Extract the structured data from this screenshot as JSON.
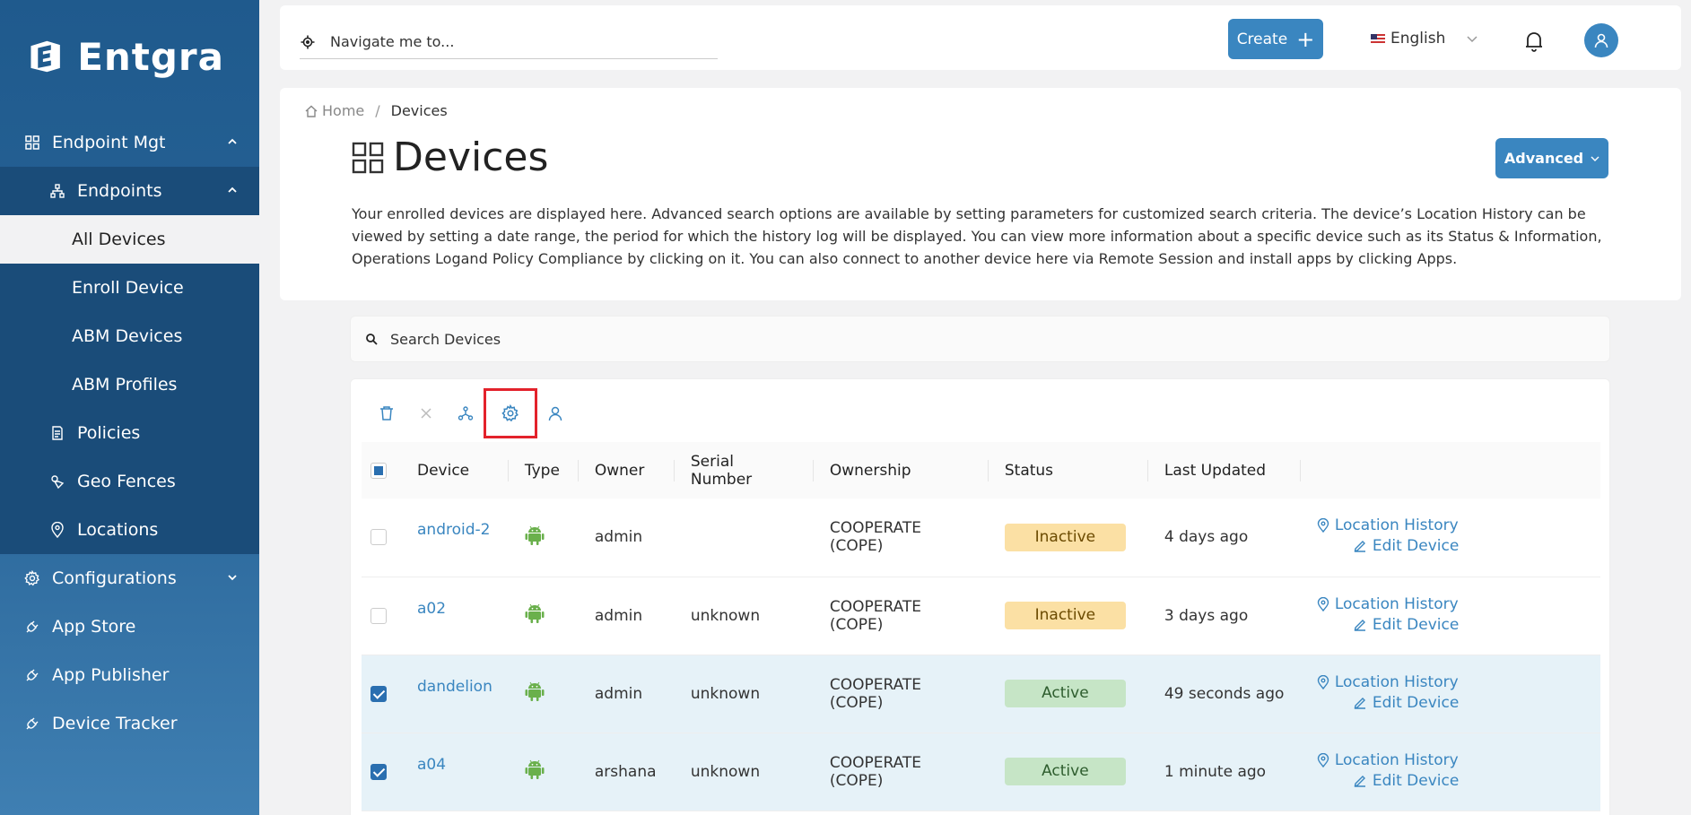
{
  "brand": {
    "name": "Entgra"
  },
  "sidebar": {
    "items": [
      {
        "label": "Endpoint Mgt"
      },
      {
        "label": "Endpoints"
      },
      {
        "label": "All Devices"
      },
      {
        "label": "Enroll Device"
      },
      {
        "label": "ABM Devices"
      },
      {
        "label": "ABM Profiles"
      },
      {
        "label": "Policies"
      },
      {
        "label": "Geo Fences"
      },
      {
        "label": "Locations"
      },
      {
        "label": "Configurations"
      },
      {
        "label": "App Store"
      },
      {
        "label": "App Publisher"
      },
      {
        "label": "Device Tracker"
      }
    ]
  },
  "header": {
    "search_placeholder": "Navigate me to...",
    "create_label": "Create",
    "language": "English"
  },
  "breadcrumb": {
    "home": "Home",
    "current": "Devices"
  },
  "page": {
    "title": "Devices",
    "advanced_label": "Advanced",
    "description": "Your enrolled devices are displayed here. Advanced search options are available by setting parameters for customized search criteria. The device’s Location History can be viewed by setting a date range, the period for which the history log will be displayed. You can view more information about a specific device such as its Status & Information, Operations Logand Policy Compliance by clicking on it. You can also connect to another device here via Remote Session and install apps by clicking Apps."
  },
  "search": {
    "placeholder": "Search Devices"
  },
  "toolbar": {
    "icons": [
      "delete-icon",
      "close-icon",
      "group-icon",
      "settings-icon",
      "user-icon"
    ]
  },
  "table": {
    "columns": [
      "Device",
      "Type",
      "Owner",
      "Serial Number",
      "Ownership",
      "Status",
      "Last Updated"
    ],
    "rows": [
      {
        "device": "android-2",
        "type": "android",
        "owner": "admin",
        "serial": "",
        "ownership": "COOPERATE (COPE)",
        "status": "Inactive",
        "last_updated": "4 days ago",
        "selected": false,
        "location_history": "Location History",
        "edit_device": "Edit Device"
      },
      {
        "device": "a02",
        "type": "android",
        "owner": "admin",
        "serial": "unknown",
        "ownership": "COOPERATE (COPE)",
        "status": "Inactive",
        "last_updated": "3 days ago",
        "selected": false,
        "location_history": "Location History",
        "edit_device": "Edit Device"
      },
      {
        "device": "dandelion",
        "type": "android",
        "owner": "admin",
        "serial": "unknown",
        "ownership": "COOPERATE (COPE)",
        "status": "Active",
        "last_updated": "49 seconds ago",
        "selected": true,
        "location_history": "Location History",
        "edit_device": "Edit Device"
      },
      {
        "device": "a04",
        "type": "android",
        "owner": "arshana",
        "serial": "unknown",
        "ownership": "COOPERATE (COPE)",
        "status": "Active",
        "last_updated": "1 minute ago",
        "selected": true,
        "location_history": "Location History",
        "edit_device": "Edit Device"
      }
    ]
  },
  "colors": {
    "primary": "#3a86c0",
    "sidebar": "#1f5a8d",
    "inactive": "#fbe0a4",
    "active": "#c6e5c6",
    "android": "#6ab04c",
    "highlight": "#e3222b"
  }
}
